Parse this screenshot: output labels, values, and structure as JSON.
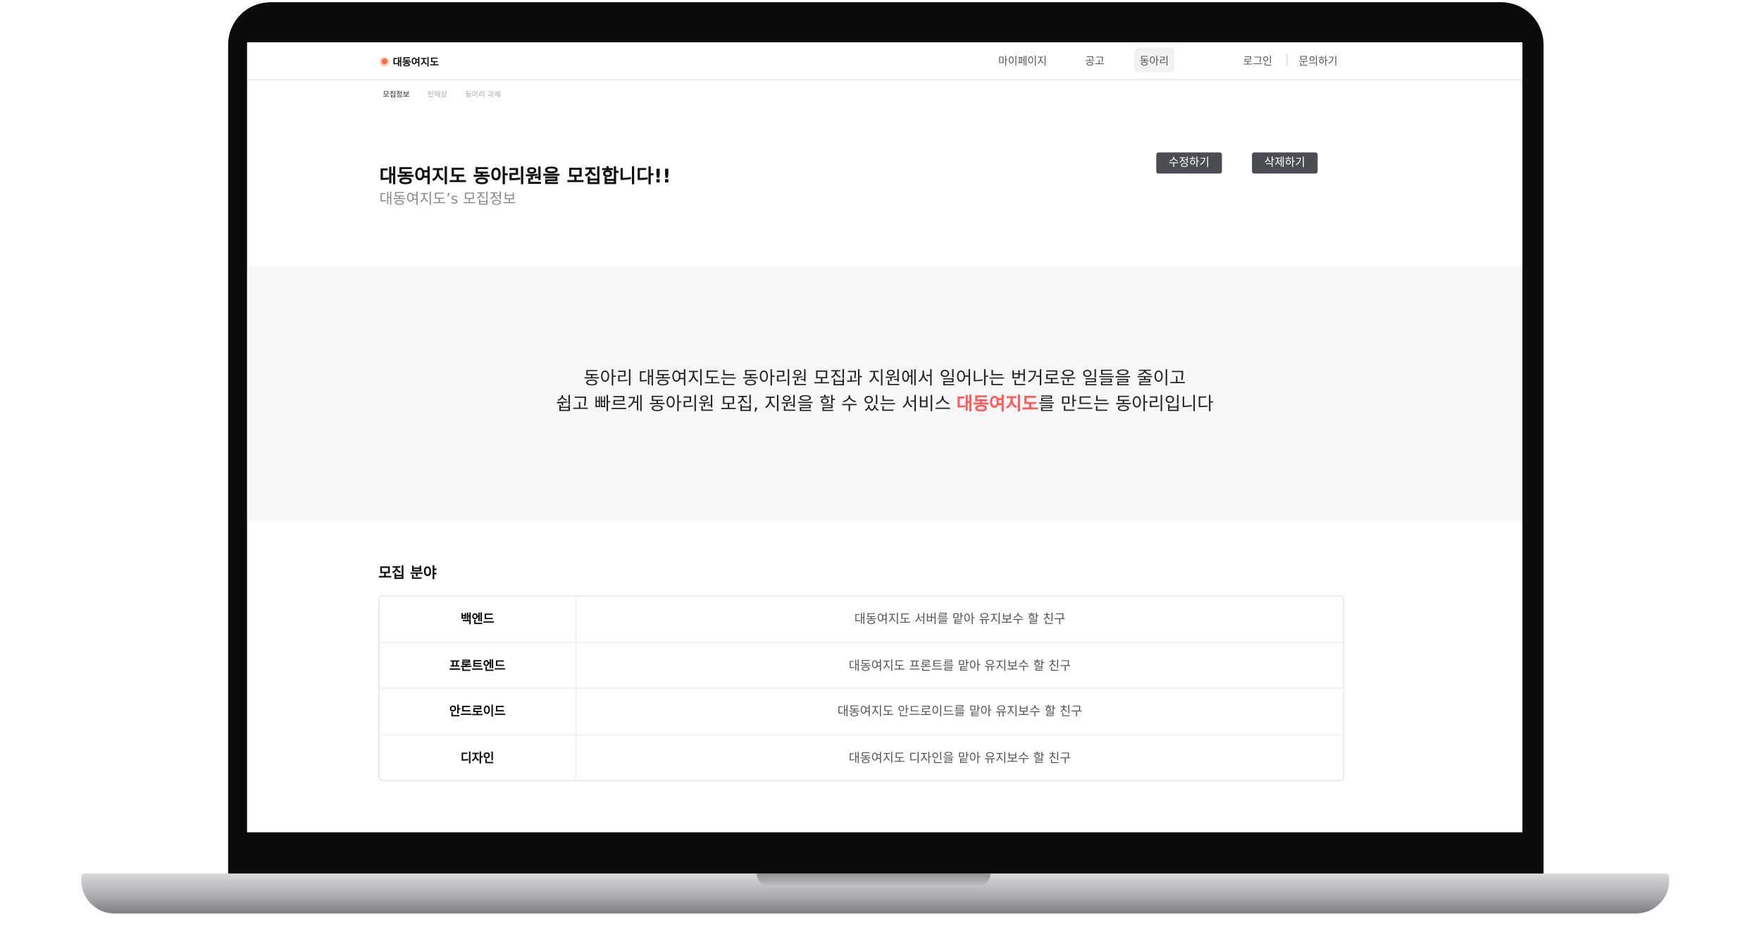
{
  "header": {
    "logo": "대동여지도",
    "logo_icon": "paw-icon",
    "nav": [
      "마이페이지",
      "공고",
      "동아리"
    ],
    "active_nav": "동아리",
    "login": "로그인",
    "contact": "문의하기"
  },
  "subnav": [
    "모집정보",
    "인재상",
    "동아리 과제"
  ],
  "page": {
    "title": "대동여지도 동아리원을 모집합니다!!",
    "subtitle": "대동여지도’s 모집정보",
    "edit": "수정하기",
    "delete": "삭제하기"
  },
  "intro": {
    "line1": "동아리 대동여지도는  동아리원 모집과 지원에서 일어나는 번거로운 일들을 줄이고",
    "line2_pre": "쉽고 빠르게 동아리원 모집, 지원을 할 수 있는 서비스 ",
    "line2_hl": "대동여지도",
    "line2_post": "를 만드는 동아리입니다",
    "highlight_color": "#ff5a5a"
  },
  "fields": {
    "title": "모집 분야",
    "rows": [
      {
        "name": "백엔드",
        "desc": "대동여지도 서버를 맡아 유지보수 할 친구"
      },
      {
        "name": "프론트엔드",
        "desc": "대동여지도 프론트를  맡아 유지보수 할 친구"
      },
      {
        "name": "안드로이드",
        "desc": "대동여지도 안드로이드를  맡아 유지보수 할 친구"
      },
      {
        "name": "디자인",
        "desc": "대동여지도 디자인을 맡아 유지보수 할 친구"
      }
    ]
  }
}
